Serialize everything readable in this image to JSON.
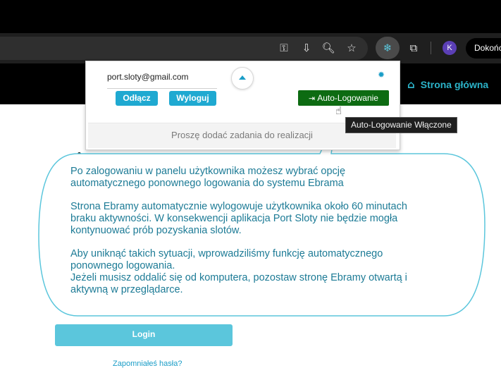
{
  "browser": {
    "finish_label": "Dokończ",
    "profile_initial": "K"
  },
  "header": {
    "home_label": "Strona główna"
  },
  "popup": {
    "email": "port.sloty@gmail.com",
    "disconnect_label": "Odłącz",
    "logout_label": "Wyloguj",
    "auto_login_label": "Auto-Logowanie",
    "tasks_message": "Proszę dodać zadania do realizacji"
  },
  "tooltip": {
    "text": "Auto-Logowanie Włączone"
  },
  "callout": {
    "p1a": "Po zalogowaniu w panelu użytkownika możesz wybrać opcję",
    "p1b": "automatycznego ponownego logowania do systemu Ebrama",
    "p2a": "Strona Ebramy automatycznie wylogowuje użytkownika około 60 minutach",
    "p2b": "braku aktywności. W konsekwencji aplikacja Port Sloty nie będzie mogła",
    "p2c": "kontynuować prób pozyskania slotów.",
    "p3a": "Aby uniknąć takich sytuacji, wprowadziliśmy funkcję automatycznego",
    "p3b": "ponownego logowania.",
    "p3c": "Jeżeli musisz oddalić się od komputera, pozostaw stronę Ebramy otwartą i",
    "p3d": "aktywną w przeglądarce."
  },
  "form": {
    "login_label": "Login",
    "bottom_link": "Zapomniałeś hasła?"
  }
}
